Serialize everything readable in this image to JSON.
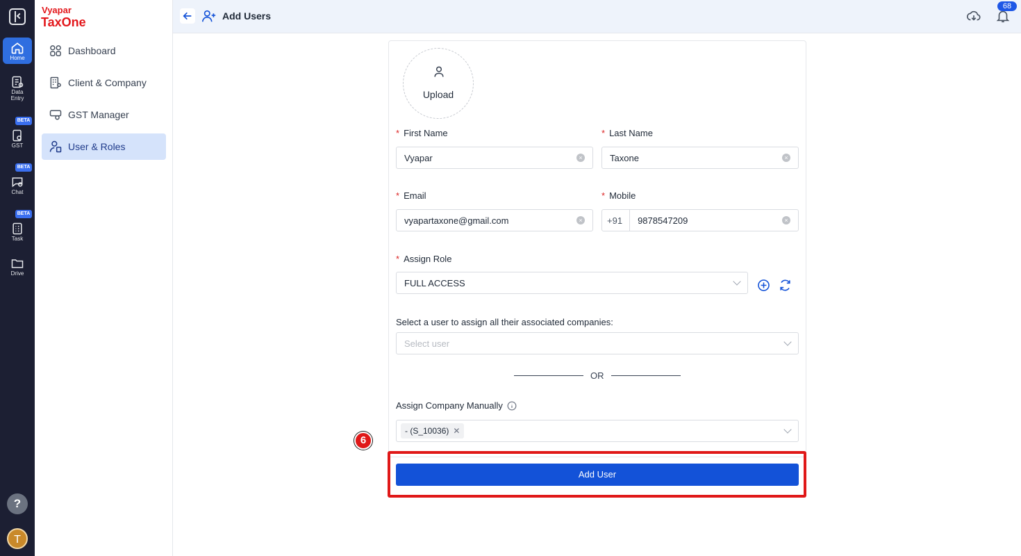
{
  "rail": {
    "items": [
      {
        "label": "Home",
        "icon": "home-icon"
      },
      {
        "label_line1": "Data",
        "label_line2": "Entry",
        "icon": "data-entry-icon"
      },
      {
        "label": "GST",
        "icon": "gst-icon",
        "badge": "BETA"
      },
      {
        "label": "Chat",
        "icon": "chat-icon",
        "badge": "BETA"
      },
      {
        "label": "Task",
        "icon": "task-icon",
        "badge": "BETA"
      },
      {
        "label": "Drive",
        "icon": "drive-icon"
      }
    ],
    "help": "?",
    "avatar": "T"
  },
  "brand": {
    "top": "Vyapar",
    "bottom": "TaxOne",
    "color": "#e3171b"
  },
  "sidebar": {
    "items": [
      {
        "label": "Dashboard",
        "icon": "dashboard-icon"
      },
      {
        "label": "Client & Company",
        "icon": "client-company-icon"
      },
      {
        "label": "GST Manager",
        "icon": "gst-manager-icon"
      },
      {
        "label": "User & Roles",
        "icon": "user-roles-icon",
        "active": true
      }
    ]
  },
  "header": {
    "title": "Add Users",
    "notification_count": "68"
  },
  "form": {
    "upload_label": "Upload",
    "first_name": {
      "label": "First Name",
      "value": "Vyapar"
    },
    "last_name": {
      "label": "Last Name",
      "value": "Taxone"
    },
    "email": {
      "label": "Email",
      "value": "vyapartaxone@gmail.com"
    },
    "mobile": {
      "label": "Mobile",
      "prefix": "+91",
      "value": "9878547209"
    },
    "role": {
      "label": "Assign Role",
      "value": "FULL ACCESS"
    },
    "select_user": {
      "label": "Select a user to assign all their associated companies:",
      "placeholder": "Select user"
    },
    "or_text": "OR",
    "assign_company": {
      "label": "Assign Company Manually",
      "tags": [
        "- (S_10036)"
      ]
    },
    "submit_label": "Add User"
  },
  "annotation": {
    "step": "6",
    "color": "#e01818"
  },
  "colors": {
    "primary": "#1352d8",
    "rail_bg": "#1c1f33",
    "active_nav": "#d5e3fb"
  }
}
